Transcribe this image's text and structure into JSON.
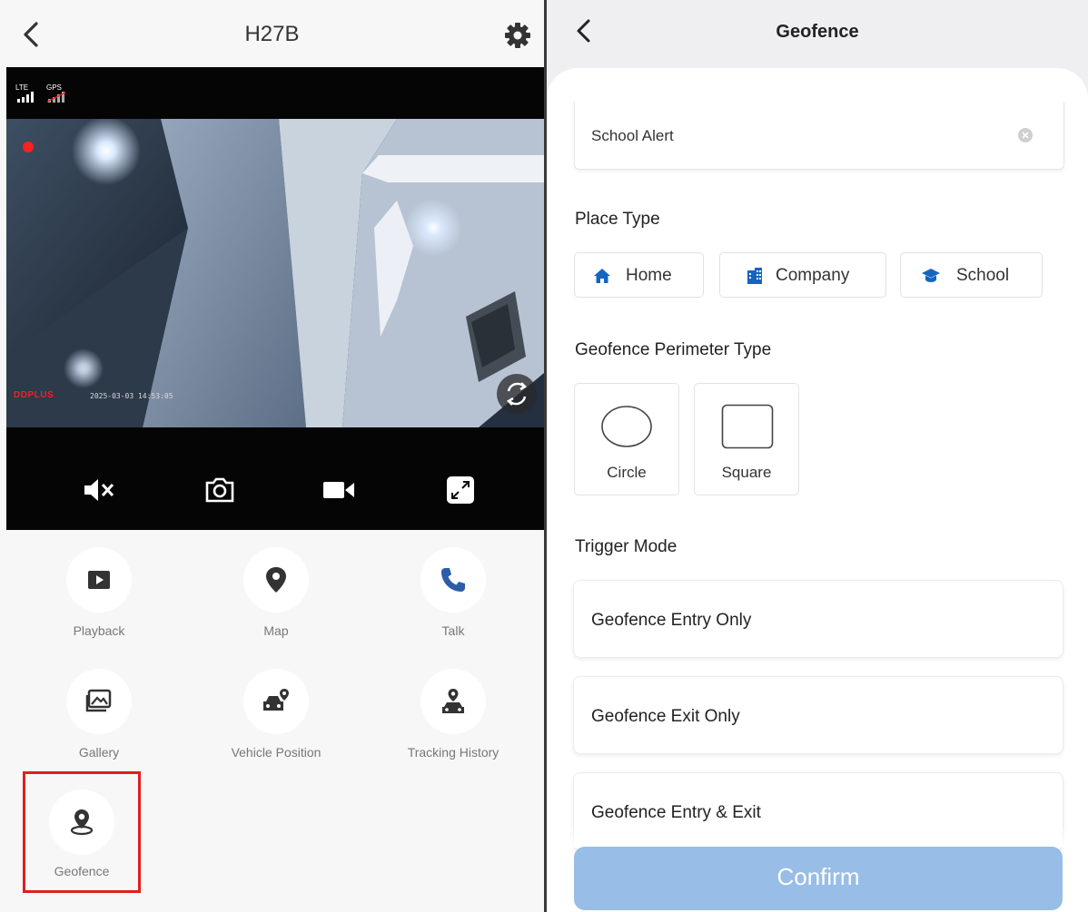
{
  "left": {
    "title": "H27B",
    "signal": {
      "lte": "LTE",
      "gps": "GPS"
    },
    "osd": {
      "brand": "DDPLUS",
      "timestamp": "2025-03-03 14:53:05"
    },
    "controls": [
      {
        "name": "mute-icon"
      },
      {
        "name": "camera-snapshot-icon"
      },
      {
        "name": "video-record-icon"
      },
      {
        "name": "fullscreen-icon"
      }
    ],
    "features": {
      "playback": "Playback",
      "map": "Map",
      "talk": "Talk",
      "gallery": "Gallery",
      "vehicle_position": "Vehicle Position",
      "tracking_history": "Tracking History",
      "geofence": "Geofence"
    },
    "colors": {
      "highlight": "#e01e1e",
      "video_bg": "#050505"
    }
  },
  "right": {
    "title": "Geofence",
    "name_value": "School Alert",
    "place_type_label": "Place Type",
    "place_types": [
      "Home",
      "Company",
      "School"
    ],
    "perimeter_label": "Geofence Perimeter Type",
    "perimeter_types": [
      "Circle",
      "Square"
    ],
    "trigger_label": "Trigger Mode",
    "triggers": [
      "Geofence Entry Only",
      "Geofence Exit Only",
      "Geofence Entry & Exit"
    ],
    "confirm_label": "Confirm",
    "colors": {
      "accent": "#1565c0",
      "confirm": "#98bde6"
    }
  }
}
